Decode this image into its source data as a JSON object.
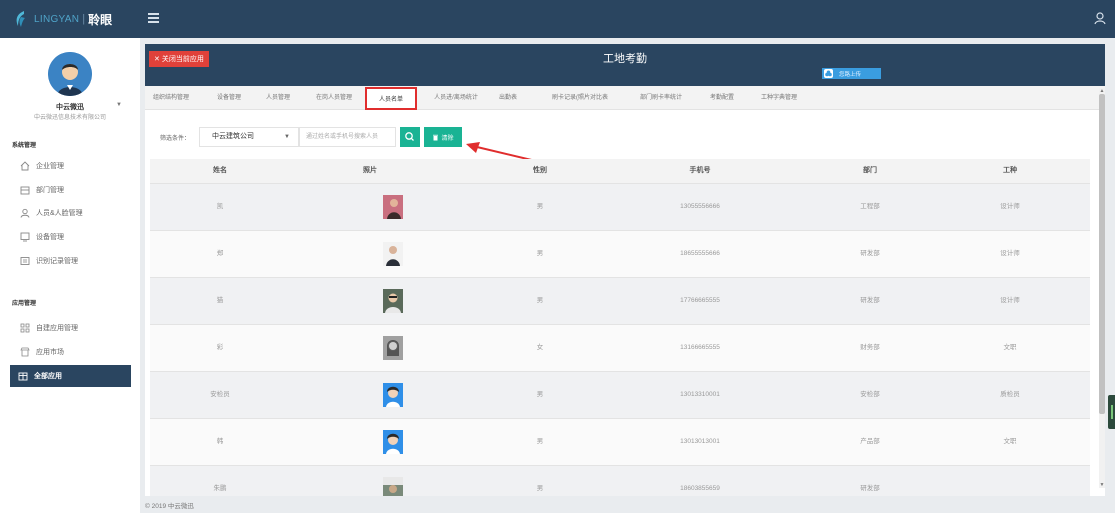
{
  "brand": {
    "en": "LINGYAN",
    "sep": "|",
    "cn": "聆眼"
  },
  "colors": {
    "topbar": "#2a4560",
    "accent_green": "#1ab394",
    "close_red": "#e0413a",
    "upload_blue": "#3a9de0",
    "highlight_red": "#e02d2d"
  },
  "user": {
    "name": "中云微迅",
    "company": "中云微迅信息技术有限公司"
  },
  "sidebar": {
    "section_system": "系统管理",
    "system_items": [
      {
        "label": "企业管理",
        "icon": "home-icon"
      },
      {
        "label": "部门管理",
        "icon": "building-icon"
      },
      {
        "label": "人员&人脸管理",
        "icon": "person-icon"
      },
      {
        "label": "设备管理",
        "icon": "device-icon"
      },
      {
        "label": "识别记录管理",
        "icon": "record-icon"
      }
    ],
    "section_apps": "应用管理",
    "app_items": [
      {
        "label": "自建应用管理",
        "icon": "grid-icon"
      },
      {
        "label": "应用市场",
        "icon": "store-icon"
      },
      {
        "label": "全部应用",
        "icon": "box-icon",
        "active": true
      }
    ]
  },
  "header": {
    "close_app": "关闭当前应用",
    "close_icon": "✕",
    "title": "工地考勤",
    "upload_label": "您路上传"
  },
  "tabs": [
    {
      "label": "组织结构管理"
    },
    {
      "label": "设备管理"
    },
    {
      "label": "人员管理"
    },
    {
      "label": "在岗人员管理"
    },
    {
      "label": "人员名单",
      "active": true
    },
    {
      "label": "人员进/离场统计"
    },
    {
      "label": "出勤表"
    },
    {
      "label": "刷卡记录(照片对比表"
    },
    {
      "label": "部门刷卡率统计"
    },
    {
      "label": "考勤配置"
    },
    {
      "label": "工种字典管理"
    }
  ],
  "filter": {
    "label": "筛选条件：",
    "company": "中云建筑公司",
    "search_placeholder": "通过姓名或手机号搜索人员",
    "clear_label": "清除"
  },
  "table": {
    "columns": [
      "姓名",
      "照片",
      "性别",
      "手机号",
      "部门",
      "工种"
    ],
    "rows": [
      {
        "name": "凯",
        "gender": "男",
        "phone": "13055556666",
        "dept": "工程部",
        "job": "设计师"
      },
      {
        "name": "郑",
        "gender": "男",
        "phone": "18655555666",
        "dept": "研发部",
        "job": "设计师"
      },
      {
        "name": "猫",
        "gender": "男",
        "phone": "17766665555",
        "dept": "研发部",
        "job": "设计师"
      },
      {
        "name": "彩",
        "gender": "女",
        "phone": "13166665555",
        "dept": "财务部",
        "job": "文职"
      },
      {
        "name": "安检员",
        "gender": "男",
        "phone": "13013310001",
        "dept": "安检部",
        "job": "质检员"
      },
      {
        "name": "韩",
        "gender": "男",
        "phone": "13013013001",
        "dept": "产品部",
        "job": "文职"
      },
      {
        "name": "朱鹏",
        "gender": "男",
        "phone": "18603855659",
        "dept": "研发部",
        "job": ""
      }
    ]
  },
  "footer": "© 2019 中云微迅"
}
